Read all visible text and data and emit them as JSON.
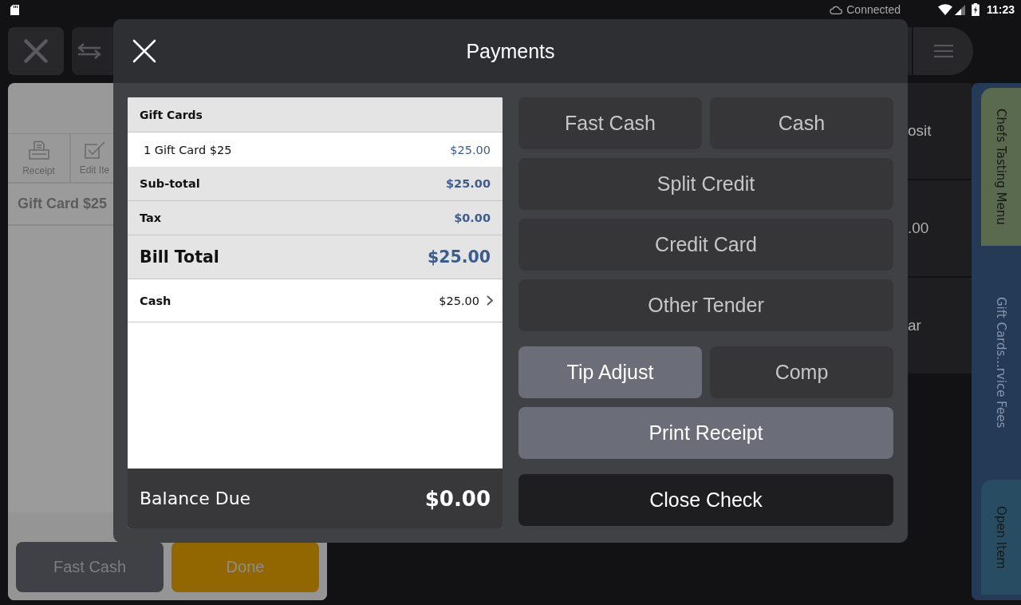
{
  "status_bar": {
    "connection": "Connected",
    "time": "11:23"
  },
  "order_panel": {
    "toolbar": [
      {
        "kind": "receipt",
        "label": "Receipt"
      },
      {
        "kind": "edit",
        "label": "Edit Ite"
      }
    ],
    "items": [
      {
        "name": "Gift Card $25"
      }
    ],
    "buttons": [
      {
        "kind": "secondary",
        "label": "Fast Cash"
      },
      {
        "kind": "primary",
        "label": "Done"
      }
    ]
  },
  "menu_tiles": [
    {
      "label": "osit"
    },
    {
      "label": ".00"
    },
    {
      "label": "ar"
    }
  ],
  "category_tabs": [
    {
      "label": "Chefs Tasting Menu",
      "color": "#5a6a4e",
      "selected": false
    },
    {
      "label": "Gift Cards...rvice Fees",
      "color": "#243a57",
      "selected": true
    },
    {
      "label": "Open Item",
      "color": "#284c62",
      "selected": false
    }
  ],
  "dialog": {
    "title": "Payments",
    "receipt": {
      "rows": [
        {
          "kind": "section",
          "label": "Gift Cards"
        },
        {
          "kind": "item",
          "label": "1 Gift Card $25",
          "amount": "$25.00"
        },
        {
          "kind": "summary",
          "label": "Sub-total",
          "amount": "$25.00"
        },
        {
          "kind": "summary",
          "label": "Tax",
          "amount": "$0.00"
        },
        {
          "kind": "total",
          "label": "Bill Total",
          "amount": "$25.00"
        },
        {
          "kind": "payment",
          "label": "Cash",
          "amount": "$25.00"
        }
      ],
      "balance": {
        "label": "Balance Due",
        "amount": "$0.00"
      }
    },
    "button_groups": [
      {
        "rows": [
          {
            "buttons": [
              {
                "label": "Fast Cash",
                "kind": "default"
              },
              {
                "label": "Cash",
                "kind": "default"
              }
            ]
          },
          {
            "buttons": [
              {
                "label": "Split Credit",
                "kind": "default"
              }
            ]
          },
          {
            "buttons": [
              {
                "label": "Credit Card",
                "kind": "default"
              }
            ]
          },
          {
            "buttons": [
              {
                "label": "Other Tender",
                "kind": "default"
              }
            ]
          }
        ]
      },
      {
        "rows": [
          {
            "buttons": [
              {
                "label": "Tip Adjust",
                "kind": "highlight"
              },
              {
                "label": "Comp",
                "kind": "default"
              }
            ]
          },
          {
            "buttons": [
              {
                "label": "Print Receipt",
                "kind": "highlight"
              }
            ]
          }
        ]
      },
      {
        "rows": [
          {
            "buttons": [
              {
                "label": "Close Check",
                "kind": "dark"
              }
            ]
          }
        ]
      }
    ]
  }
}
